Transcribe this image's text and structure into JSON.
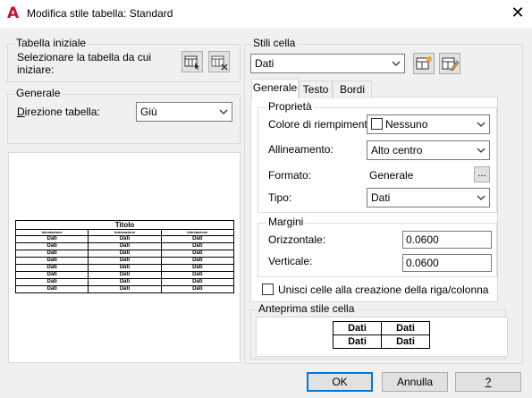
{
  "window": {
    "title": "Modifica stile tabella: Standard",
    "close_glyph": "✕"
  },
  "left": {
    "initial_table": {
      "group_label": "Tabella iniziale",
      "select_text": "Selezionare la tabella da cui iniziare:"
    },
    "general": {
      "group_label": "Generale",
      "direction_label": "Direzione tabella:",
      "direction_value": "Giù"
    },
    "preview": {
      "title": "Titolo",
      "header": [
        "Intestazione",
        "Intestazione",
        "Intestazione"
      ],
      "rows": [
        [
          "Dati",
          "Dati",
          "Dati"
        ],
        [
          "Dati",
          "Dati",
          "Dati"
        ],
        [
          "Dati",
          "Dati",
          "Dati"
        ],
        [
          "Dati",
          "Dati",
          "Dati"
        ],
        [
          "Dati",
          "Dati",
          "Dati"
        ],
        [
          "Dati",
          "Dati",
          "Dati"
        ],
        [
          "Dati",
          "Dati",
          "Dati"
        ],
        [
          "Dati",
          "Dati",
          "Dati"
        ]
      ]
    }
  },
  "right": {
    "cell_styles": {
      "group_label": "Stili cella",
      "selected": "Dati"
    },
    "tabs": [
      {
        "label": "Generale",
        "active": true
      },
      {
        "label": "Testo",
        "active": false
      },
      {
        "label": "Bordi",
        "active": false
      }
    ],
    "properties": {
      "group_label": "Proprietà",
      "fill_color_label": "Colore di riempimento:",
      "fill_color_value": "Nessuno",
      "alignment_label": "Allineamento:",
      "alignment_value": "Alto centro",
      "format_label": "Formato:",
      "format_value": "Generale",
      "format_button": "...",
      "type_label": "Tipo:",
      "type_value": "Dati"
    },
    "margins": {
      "group_label": "Margini",
      "horizontal_label": "Orizzontale:",
      "horizontal_value": "0.0600",
      "vertical_label": "Verticale:",
      "vertical_value": "0.0600"
    },
    "merge_label": "Unisci celle alla creazione della riga/colonna",
    "merge_checked": false,
    "cell_preview": {
      "group_label": "Anteprima stile cella",
      "cells": [
        [
          "Dati",
          "Dati"
        ],
        [
          "Dati",
          "Dati"
        ]
      ]
    }
  },
  "footer": {
    "ok": "OK",
    "cancel": "Annulla",
    "help": "?"
  },
  "colors": {
    "app_icon": "#c8102e",
    "focus_border": "#0078d7"
  }
}
